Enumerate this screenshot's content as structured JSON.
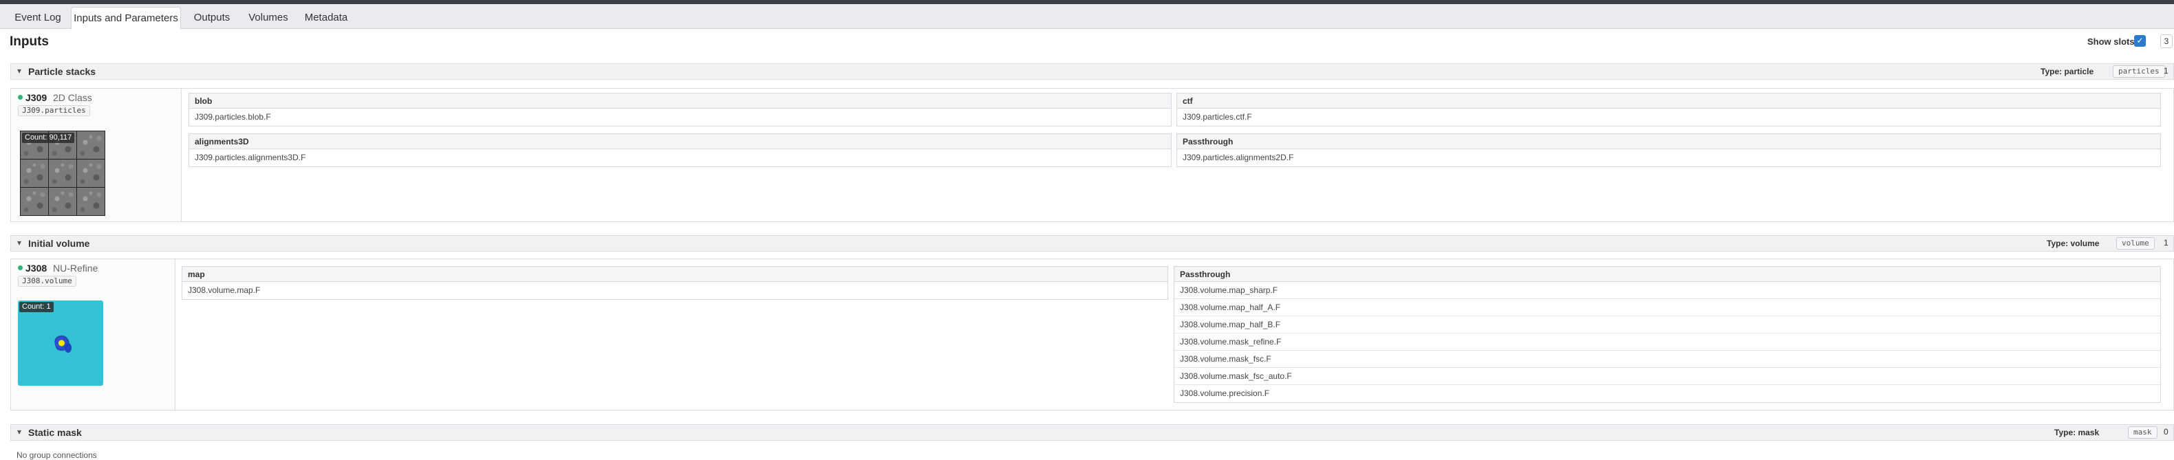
{
  "tabs": [
    {
      "label": "Event Log",
      "active": false
    },
    {
      "label": "Inputs and Parameters",
      "active": true
    },
    {
      "label": "Outputs",
      "active": false
    },
    {
      "label": "Volumes",
      "active": false
    },
    {
      "label": "Metadata",
      "active": false
    }
  ],
  "page": {
    "title": "Inputs"
  },
  "show_slots": {
    "label": "Show slots",
    "checked": true,
    "count": "3"
  },
  "sections": {
    "particles": {
      "title": "Particle stacks",
      "type_label": "Type: particle",
      "type_value": "particles",
      "count": "1",
      "job": {
        "id": "J309",
        "type": "2D Class",
        "output": "J309.particles",
        "badge": "Count: 90,117"
      },
      "slots": [
        {
          "name": "blob",
          "values": [
            "J309.particles.blob.F"
          ]
        },
        {
          "name": "ctf",
          "values": [
            "J309.particles.ctf.F"
          ]
        },
        {
          "name": "alignments3D",
          "values": [
            "J309.particles.alignments3D.F"
          ]
        },
        {
          "name": "Passthrough",
          "values": [
            "J309.particles.alignments2D.F"
          ]
        }
      ]
    },
    "volume": {
      "title": "Initial volume",
      "type_label": "Type: volume",
      "type_value": "volume",
      "count": "1",
      "job": {
        "id": "J308",
        "type": "NU-Refine",
        "output": "J308.volume",
        "badge": "Count: 1"
      },
      "slots": [
        {
          "name": "map",
          "values": [
            "J308.volume.map.F"
          ]
        },
        {
          "name": "Passthrough",
          "values": [
            "J308.volume.map_sharp.F",
            "J308.volume.map_half_A.F",
            "J308.volume.map_half_B.F",
            "J308.volume.mask_refine.F",
            "J308.volume.mask_fsc.F",
            "J308.volume.mask_fsc_auto.F",
            "J308.volume.precision.F"
          ]
        }
      ]
    },
    "mask": {
      "title": "Static mask",
      "type_label": "Type: mask",
      "type_value": "mask",
      "count": "0",
      "empty_text": "No group connections"
    }
  },
  "icons": {
    "caret": "chevron-down-icon",
    "check": "checkmark-icon",
    "status": "status-dot-icon"
  },
  "colors": {
    "accent": "#2a7bd0",
    "status_green": "#2bb673",
    "volume_bg": "#33c3d4"
  }
}
